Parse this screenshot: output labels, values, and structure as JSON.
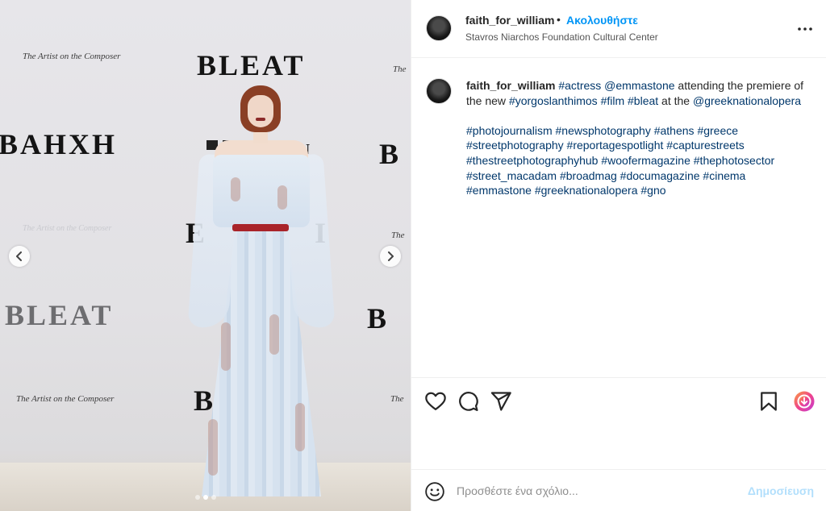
{
  "photo": {
    "wall_texts": {
      "bleat_top": "BLEAT",
      "bahxh_left": "BAHXH",
      "bleat_left": "BLEAT",
      "bleat_bottom_center": "BL",
      "b_right_1": "B",
      "b_right_2": "B",
      "e_center": "E",
      "h_center": "I",
      "eon": "EON",
      "artist_1": "The Artist on the Composer",
      "artist_2": "The Artist on the Composer",
      "artist_3": "The Artist on the Composer",
      "artist_faint": "The Artist on the Composer",
      "the_right_1": "The",
      "the_right_2": "The",
      "the_right_3": "The"
    },
    "nav": {
      "prev_icon": "chevron-left-icon",
      "next_icon": "chevron-right-icon"
    },
    "carousel": {
      "count": 3,
      "active_index": 1
    }
  },
  "header": {
    "username": "faith_for_william",
    "separator": "•",
    "follow_label": "Ακολουθήστε",
    "location": "Stavros Niarchos Foundation Cultural Center",
    "more_icon": "more-horizontal-icon"
  },
  "caption": {
    "username": "faith_for_william",
    "line1": [
      {
        "text": "#actress",
        "tag": true
      },
      {
        "text": " ",
        "tag": false
      },
      {
        "text": "@emmastone",
        "tag": true
      },
      {
        "text": " attending the premiere of the new ",
        "tag": false
      },
      {
        "text": "#yorgoslanthimos",
        "tag": true
      },
      {
        "text": " ",
        "tag": false
      },
      {
        "text": "#film",
        "tag": true
      },
      {
        "text": " ",
        "tag": false
      },
      {
        "text": "#bleat",
        "tag": true
      },
      {
        "text": " at the ",
        "tag": false
      },
      {
        "text": "@greeknationalopera",
        "tag": true
      }
    ],
    "hashtags": [
      "#photojournalism",
      "#newsphotography",
      "#athens",
      "#greece",
      "#streetphotography",
      "#reportagespotlight",
      "#capturestreets",
      "#thestreetphotographyhub",
      "#woofermagazine",
      "#thephotosector",
      "#street_macadam",
      "#broadmag",
      "#documagazine",
      "#cinema",
      "#emmastone",
      "#greeknationalopera",
      "#gno"
    ]
  },
  "actions": {
    "like_icon": "heart-icon",
    "comment_icon": "comment-icon",
    "share_icon": "share-icon",
    "save_icon": "bookmark-icon",
    "extension_icon": "download-extension-icon",
    "accent": "#0095f6"
  },
  "comment": {
    "emoji_icon": "emoji-icon",
    "placeholder": "Προσθέστε ένα σχόλιο...",
    "post_label": "Δημοσίευση"
  }
}
